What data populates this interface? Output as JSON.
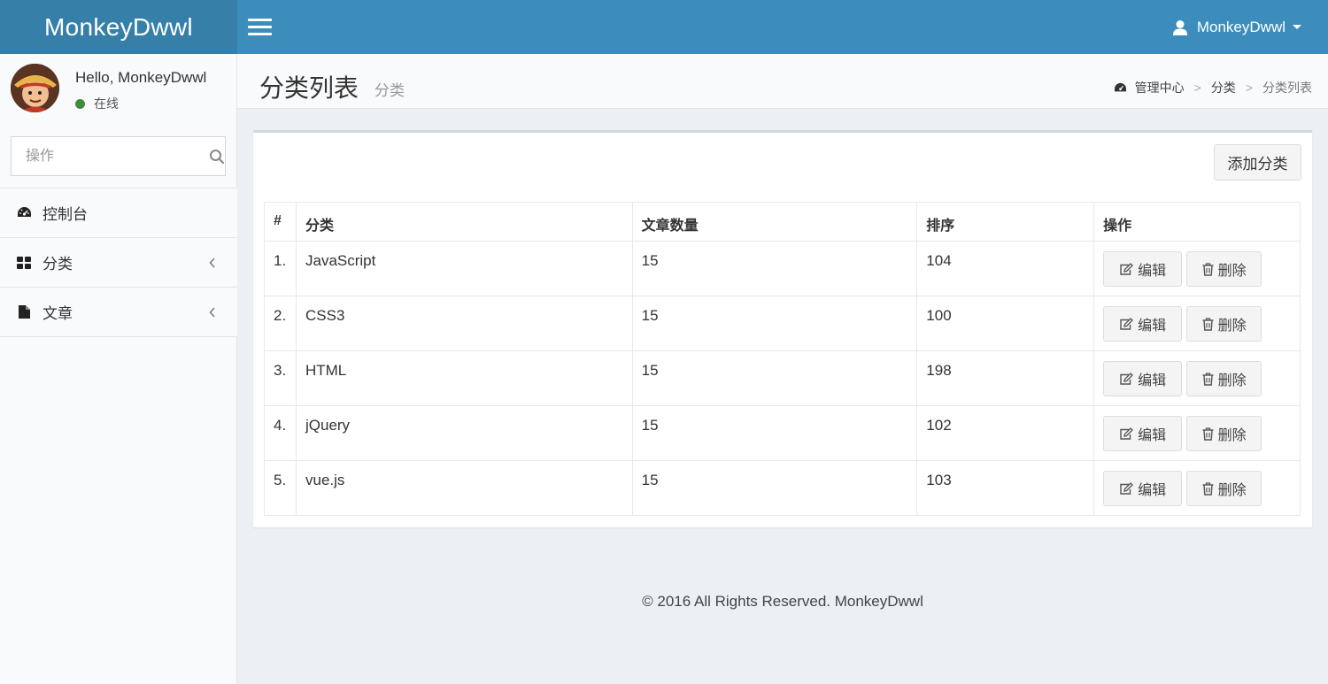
{
  "header": {
    "logo": "MonkeyDwwl",
    "user_name": "MonkeyDwwl"
  },
  "sidebar": {
    "hello": "Hello, MonkeyDwwl",
    "status": "在线",
    "search_placeholder": "操作",
    "menu": [
      {
        "label": "控制台",
        "icon": "dashboard-icon"
      },
      {
        "label": "分类",
        "icon": "grid-icon"
      },
      {
        "label": "文章",
        "icon": "file-icon"
      }
    ]
  },
  "content_header": {
    "title": "分类列表",
    "subtitle": "分类",
    "breadcrumb": [
      "管理中心",
      "分类",
      "分类列表"
    ]
  },
  "box": {
    "add_button": "添加分类",
    "columns": [
      "#",
      "分类",
      "文章数量",
      "排序",
      "操作"
    ],
    "rows": [
      {
        "index": "1.",
        "name": "JavaScript",
        "count": "15",
        "order": "104"
      },
      {
        "index": "2.",
        "name": "CSS3",
        "count": "15",
        "order": "100"
      },
      {
        "index": "3.",
        "name": "HTML",
        "count": "15",
        "order": "198"
      },
      {
        "index": "4.",
        "name": "jQuery",
        "count": "15",
        "order": "102"
      },
      {
        "index": "5.",
        "name": "vue.js",
        "count": "15",
        "order": "103"
      }
    ],
    "edit_label": "编辑",
    "delete_label": "删除"
  },
  "footer": "© 2016 All Rights Reserved. MonkeyDwwl",
  "colors": {
    "header": "#3c8dbc",
    "logo_bg": "#367fa9",
    "status_online": "#3f8a3d",
    "content_bg": "#ecf0f5"
  }
}
